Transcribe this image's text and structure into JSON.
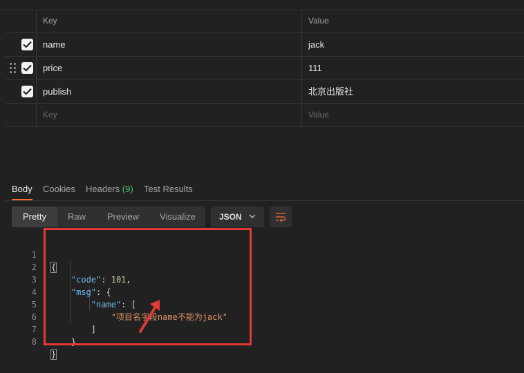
{
  "params_table": {
    "columns": {
      "key": "Key",
      "value": "Value"
    },
    "rows": [
      {
        "checked": true,
        "key": "name",
        "value": "jack"
      },
      {
        "checked": true,
        "key": "price",
        "value": "111"
      },
      {
        "checked": true,
        "key": "publish",
        "value": "北京出版社"
      }
    ],
    "new_row": {
      "key_placeholder": "Key",
      "value_placeholder": "Value"
    }
  },
  "response_tabs": {
    "body": "Body",
    "cookies": "Cookies",
    "headers": "Headers",
    "headers_count": "(9)",
    "test_results": "Test Results"
  },
  "view_modes": [
    "Pretty",
    "Raw",
    "Preview",
    "Visualize"
  ],
  "format_select": {
    "value": "JSON"
  },
  "response_body": {
    "line_numbers": [
      "1",
      "2",
      "3",
      "4",
      "5",
      "6",
      "7",
      "8"
    ],
    "open_brace": "{",
    "code_key": "\"code\"",
    "code_value": "101",
    "msg_key": "\"msg\"",
    "msg_open": "{",
    "name_key": "\"name\"",
    "name_open": "[",
    "message": "\"项目名字段name不能为jack\"",
    "name_close": "]",
    "msg_close": "}",
    "close_brace": "}"
  },
  "colors": {
    "accent": "#ff6c37",
    "annotation_red": "#e53935",
    "json_key": "#6fb6e8",
    "json_string": "#e0916a",
    "success_green": "#4fbf73"
  }
}
